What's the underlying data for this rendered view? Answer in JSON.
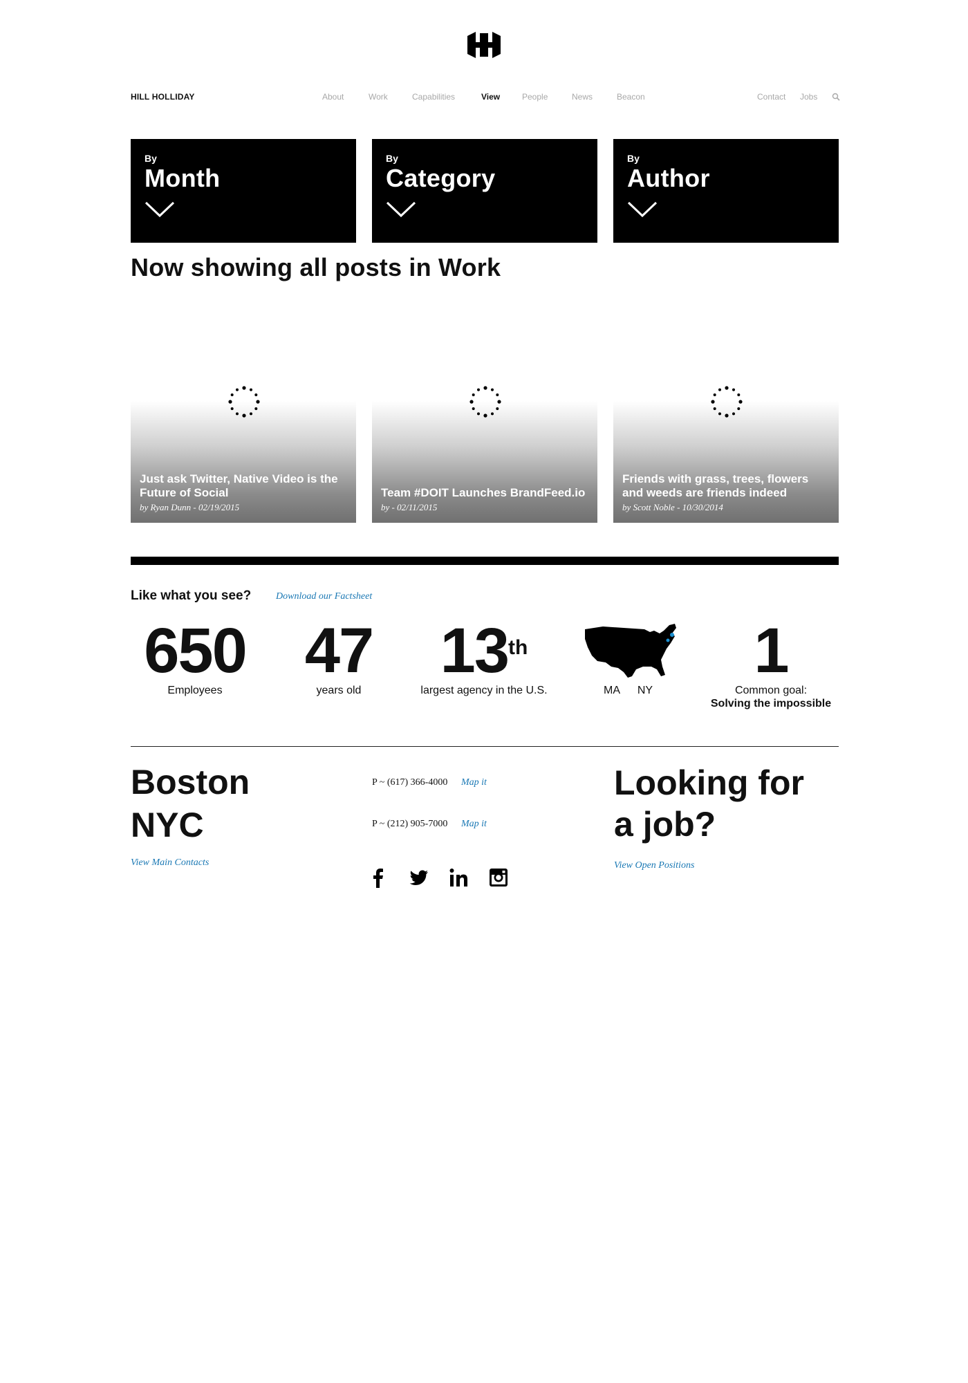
{
  "header": {
    "brand": "HILL HOLLIDAY",
    "nav": [
      "About",
      "Work",
      "Capabilities",
      "View",
      "People",
      "News",
      "Beacon"
    ],
    "active_nav": "View",
    "right_nav": [
      "Contact",
      "Jobs"
    ]
  },
  "filters": [
    {
      "by": "By",
      "label": "Month"
    },
    {
      "by": "By",
      "label": "Category"
    },
    {
      "by": "By",
      "label": "Author"
    }
  ],
  "showing_text": "Now showing all posts in Work",
  "posts": [
    {
      "title": "Just ask Twitter, Native Video is the Future of Social",
      "meta": "by Ryan Dunn - 02/19/2015"
    },
    {
      "title": "Team #DOIT Launches BrandFeed.io",
      "meta": "by - 02/11/2015"
    },
    {
      "title": "Friends with grass, trees, flowers and weeds are friends indeed",
      "meta": "by Scott Noble - 10/30/2014"
    }
  ],
  "like": {
    "heading": "Like what you see?",
    "factsheet_link": "Download our Factsheet"
  },
  "stats": {
    "employees": {
      "value": "650",
      "label": "Employees"
    },
    "years": {
      "value": "47",
      "label": "years old"
    },
    "rank": {
      "value": "13",
      "sup": "th",
      "label": "largest agency in the U.S."
    },
    "locations": {
      "ma": "MA",
      "ny": "NY"
    },
    "goal": {
      "value": "1",
      "label": "Common goal:",
      "label_bold": "Solving the impossible"
    }
  },
  "footer": {
    "city1": "Boston",
    "city2": "NYC",
    "contacts_link": "View Main Contacts",
    "phone1": "P ~ (617) 366-4000",
    "phone2": "P ~ (212) 905-7000",
    "map_link": "Map it",
    "job_line1": "Looking for",
    "job_line2": "a job?",
    "positions_link": "View Open Positions"
  },
  "colors": {
    "accent_link": "#1a78b4",
    "nav_inactive": "#a8a8a8",
    "map_highlight": "#1a8fd0"
  },
  "icons": [
    "logo-icon",
    "search-icon",
    "chevron-down-icon",
    "spinner-icon",
    "us-map-icon",
    "facebook-icon",
    "twitter-icon",
    "linkedin-icon",
    "instagram-icon"
  ]
}
